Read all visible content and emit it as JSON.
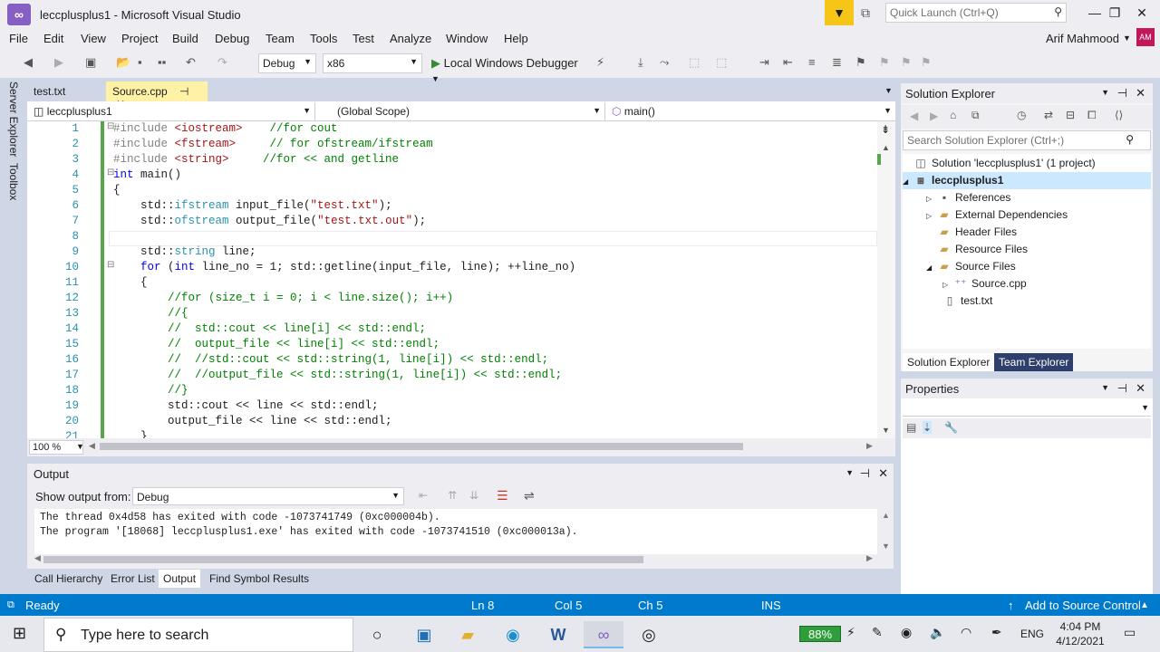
{
  "window": {
    "title": "leccplusplus1 - Microsoft Visual Studio",
    "quick_launch_placeholder": "Quick Launch (Ctrl+Q)",
    "user_name": "Arif Mahmood",
    "user_initials": "AM"
  },
  "menu": [
    "File",
    "Edit",
    "View",
    "Project",
    "Build",
    "Debug",
    "Team",
    "Tools",
    "Test",
    "Analyze",
    "Window",
    "Help"
  ],
  "toolbar": {
    "configuration": "Debug",
    "platform": "x86",
    "run_label": "Local Windows Debugger"
  },
  "side_tabs": [
    "Server Explorer",
    "Toolbox"
  ],
  "doc_tabs": [
    {
      "label": "test.txt",
      "active": false
    },
    {
      "label": "Source.cpp",
      "active": true
    }
  ],
  "navbar": {
    "project": "leccplusplus1",
    "scope": "(Global Scope)",
    "member": "main()"
  },
  "editor": {
    "line_numbers": [
      "1",
      "2",
      "3",
      "4",
      "5",
      "6",
      "7",
      "8",
      "9",
      "10",
      "11",
      "12",
      "13",
      "14",
      "15",
      "16",
      "17",
      "18",
      "19",
      "20",
      "21"
    ],
    "zoom": "100 %"
  },
  "output": {
    "title": "Output",
    "show_from_label": "Show output from:",
    "source": "Debug",
    "lines": [
      "The thread 0x4d58 has exited with code -1073741749 (0xc000004b).",
      "The program '[18068] leccplusplus1.exe' has exited with code -1073741510 (0xc000013a)."
    ]
  },
  "bottom_tabs": [
    "Call Hierarchy",
    "Error List",
    "Output",
    "Find Symbol Results"
  ],
  "solution_explorer": {
    "title": "Solution Explorer",
    "search_placeholder": "Search Solution Explorer (Ctrl+;)",
    "solution_label": "Solution 'leccplusplus1' (1 project)",
    "project": "leccplusplus1",
    "items": [
      "References",
      "External Dependencies",
      "Header Files",
      "Resource Files",
      "Source Files",
      "Source.cpp",
      "test.txt"
    ],
    "tabs": [
      "Solution Explorer",
      "Team Explorer"
    ]
  },
  "properties": {
    "title": "Properties"
  },
  "status": {
    "ready": "Ready",
    "line": "Ln 8",
    "col": "Col 5",
    "ch": "Ch 5",
    "ins": "INS",
    "source_control": "Add to Source Control"
  },
  "taskbar": {
    "search_placeholder": "Type here to search",
    "battery": "88%",
    "lang": "ENG",
    "time": "4:04 PM",
    "date": "4/12/2021"
  }
}
